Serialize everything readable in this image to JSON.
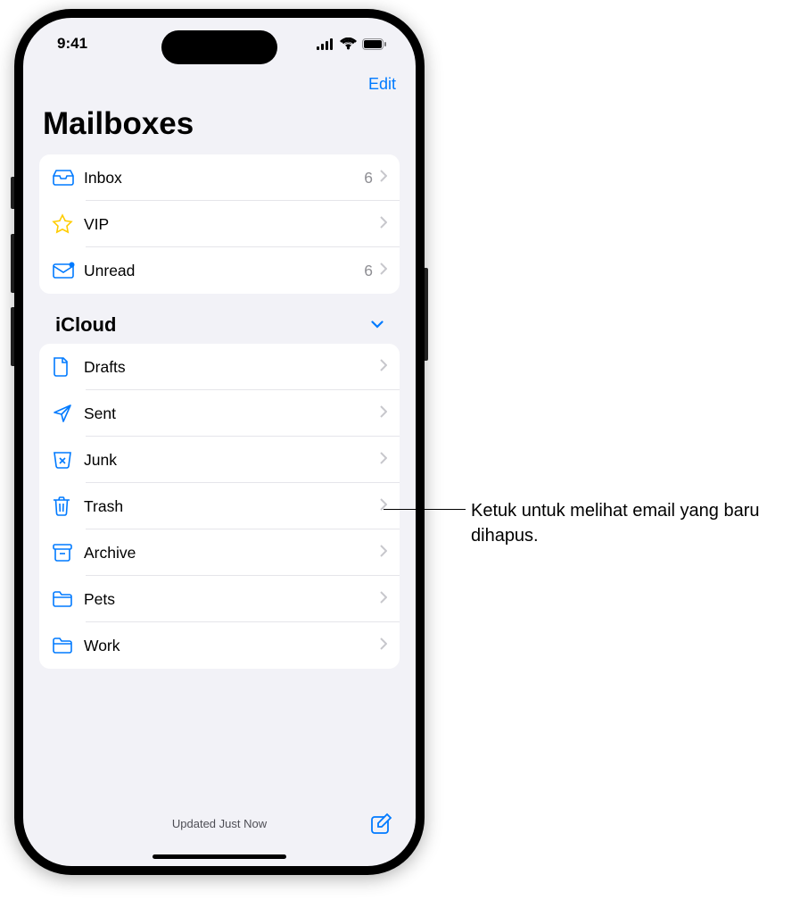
{
  "status_bar": {
    "time": "9:41"
  },
  "nav": {
    "edit_label": "Edit"
  },
  "page_title": "Mailboxes",
  "main_group": {
    "items": [
      {
        "label": "Inbox",
        "count": "6",
        "icon": "inbox-icon"
      },
      {
        "label": "VIP",
        "count": "",
        "icon": "star-icon"
      },
      {
        "label": "Unread",
        "count": "6",
        "icon": "unread-icon"
      }
    ]
  },
  "section": {
    "title": "iCloud"
  },
  "icloud_group": {
    "items": [
      {
        "label": "Drafts",
        "icon": "drafts-icon"
      },
      {
        "label": "Sent",
        "icon": "sent-icon"
      },
      {
        "label": "Junk",
        "icon": "junk-icon"
      },
      {
        "label": "Trash",
        "icon": "trash-icon"
      },
      {
        "label": "Archive",
        "icon": "archive-icon"
      },
      {
        "label": "Pets",
        "icon": "folder-icon"
      },
      {
        "label": "Work",
        "icon": "folder-icon"
      }
    ]
  },
  "toolbar": {
    "status_label": "Updated Just Now"
  },
  "callout": {
    "text": "Ketuk untuk melihat email yang baru dihapus."
  }
}
